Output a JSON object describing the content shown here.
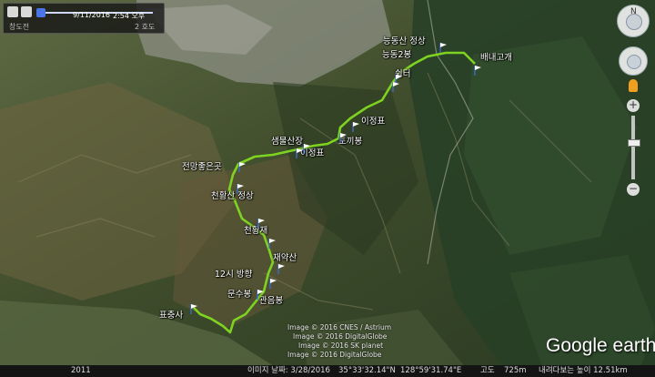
{
  "time_slider": {
    "date_label": "9/11/2016",
    "time_label": "2:54 오후",
    "left_caption": "창도전",
    "right_caption": "2 호도"
  },
  "places": [
    {
      "name": "능동산 정상"
    },
    {
      "name": "능동2봉"
    },
    {
      "name": "배내고개"
    },
    {
      "name": "쉼터"
    },
    {
      "name": "이정표"
    },
    {
      "name": "토끼봉"
    },
    {
      "name": "샘물산장"
    },
    {
      "name": "이정표"
    },
    {
      "name": "전망좋은곳"
    },
    {
      "name": "천황산 정상"
    },
    {
      "name": "천황재"
    },
    {
      "name": "재약산"
    },
    {
      "name": "12시 방향"
    },
    {
      "name": "문수봉"
    },
    {
      "name": "관음봉"
    },
    {
      "name": "표충사"
    }
  ],
  "credits": [
    "Image © 2016 CNES / Astrium",
    "Image © 2016 DigitalGlobe",
    "Image © 2016 SK planet",
    "Image © 2016 DigitalGlobe"
  ],
  "logo": "Google earth",
  "status_bar": {
    "year": "2011",
    "imagery_date": "이미지 날짜: 3/28/2016",
    "lat": "35°33'32.14\"N",
    "lon": "128°59'31.74\"E",
    "elev_label": "고도",
    "elev_value": "725m",
    "eye_alt": "내려다보는 높이 12.51km"
  },
  "colors": {
    "track": "#7ed321",
    "flag": "#ffffff",
    "pole": "#3b6fd6"
  }
}
